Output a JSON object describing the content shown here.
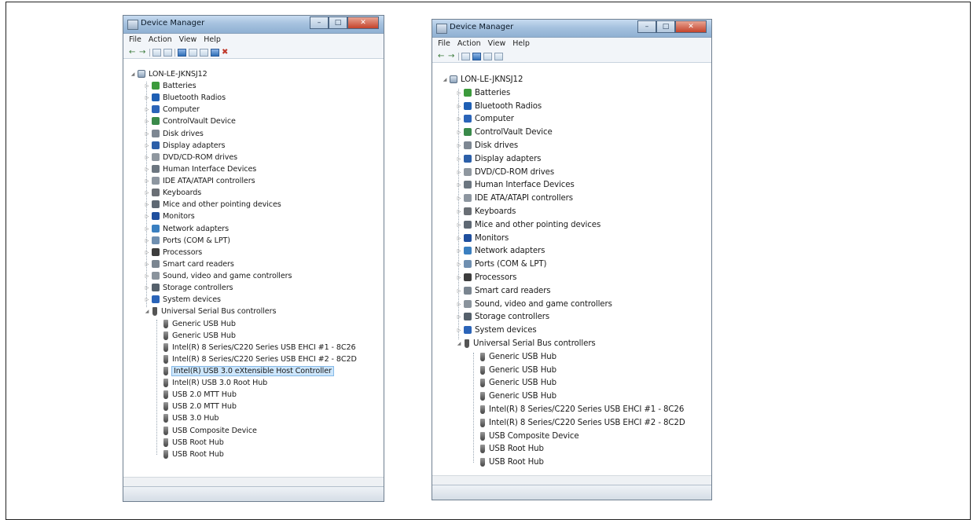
{
  "screens": [
    {
      "window_title": "Device Manager",
      "menu": [
        "File",
        "Action",
        "View",
        "Help"
      ],
      "root": "LON-LE-JKNSJ12",
      "categories": [
        {
          "label": "Batteries",
          "icon": "battery-icon",
          "color": "#3c9a3c"
        },
        {
          "label": "Bluetooth Radios",
          "icon": "bluetooth-icon",
          "color": "#1e5fb4"
        },
        {
          "label": "Computer",
          "icon": "computer-icon",
          "color": "#2b64b8"
        },
        {
          "label": "ControlVault Device",
          "icon": "controlvault-icon",
          "color": "#3a8a4a"
        },
        {
          "label": "Disk drives",
          "icon": "disk-drive-icon",
          "color": "#7d8792"
        },
        {
          "label": "Display adapters",
          "icon": "display-adapter-icon",
          "color": "#2c5fa8"
        },
        {
          "label": "DVD/CD-ROM drives",
          "icon": "dvd-drive-icon",
          "color": "#8f979f"
        },
        {
          "label": "Human Interface Devices",
          "icon": "hid-icon",
          "color": "#6c7680"
        },
        {
          "label": "IDE ATA/ATAPI controllers",
          "icon": "ide-controller-icon",
          "color": "#8d96a0"
        },
        {
          "label": "Keyboards",
          "icon": "keyboard-icon",
          "color": "#6a6f75"
        },
        {
          "label": "Mice and other pointing devices",
          "icon": "mouse-icon",
          "color": "#5e6873"
        },
        {
          "label": "Monitors",
          "icon": "monitor-icon",
          "color": "#1f4f9e"
        },
        {
          "label": "Network adapters",
          "icon": "network-adapter-icon",
          "color": "#3a7fc0"
        },
        {
          "label": "Ports (COM & LPT)",
          "icon": "port-icon",
          "color": "#6f8fb0"
        },
        {
          "label": "Processors",
          "icon": "processor-icon",
          "color": "#3d3d3d"
        },
        {
          "label": "Smart card readers",
          "icon": "smart-card-icon",
          "color": "#7a8590"
        },
        {
          "label": "Sound, video and game controllers",
          "icon": "sound-icon",
          "color": "#8a939c"
        },
        {
          "label": "Storage controllers",
          "icon": "storage-controller-icon",
          "color": "#55606b"
        },
        {
          "label": "System devices",
          "icon": "system-devices-icon",
          "color": "#2b64b8"
        },
        {
          "label": "Universal Serial Bus controllers",
          "icon": "usb-icon",
          "color": "#555555"
        }
      ],
      "usb_children": [
        "Generic USB Hub",
        "Generic USB Hub",
        "Intel(R) 8 Series/C220 Series USB EHCI #1 - 8C26",
        "Intel(R) 8 Series/C220 Series USB EHCI #2 - 8C2D",
        "Intel(R) USB 3.0 eXtensible Host Controller",
        "Intel(R) USB 3.0 Root Hub",
        "USB 2.0 MTT Hub",
        "USB 2.0 MTT Hub",
        "USB 3.0 Hub",
        "USB Composite Device",
        "USB Root Hub",
        "USB Root Hub"
      ],
      "selected_child": 4
    },
    {
      "window_title": "Device Manager",
      "menu": [
        "File",
        "Action",
        "View",
        "Help"
      ],
      "root": "LON-LE-JKNSJ12",
      "categories": [
        {
          "label": "Batteries",
          "icon": "battery-icon",
          "color": "#3c9a3c"
        },
        {
          "label": "Bluetooth Radios",
          "icon": "bluetooth-icon",
          "color": "#1e5fb4"
        },
        {
          "label": "Computer",
          "icon": "computer-icon",
          "color": "#2b64b8"
        },
        {
          "label": "ControlVault Device",
          "icon": "controlvault-icon",
          "color": "#3a8a4a"
        },
        {
          "label": "Disk drives",
          "icon": "disk-drive-icon",
          "color": "#7d8792"
        },
        {
          "label": "Display adapters",
          "icon": "display-adapter-icon",
          "color": "#2c5fa8"
        },
        {
          "label": "DVD/CD-ROM drives",
          "icon": "dvd-drive-icon",
          "color": "#8f979f"
        },
        {
          "label": "Human Interface Devices",
          "icon": "hid-icon",
          "color": "#6c7680"
        },
        {
          "label": "IDE ATA/ATAPI controllers",
          "icon": "ide-controller-icon",
          "color": "#8d96a0"
        },
        {
          "label": "Keyboards",
          "icon": "keyboard-icon",
          "color": "#6a6f75"
        },
        {
          "label": "Mice and other pointing devices",
          "icon": "mouse-icon",
          "color": "#5e6873"
        },
        {
          "label": "Monitors",
          "icon": "monitor-icon",
          "color": "#1f4f9e"
        },
        {
          "label": "Network adapters",
          "icon": "network-adapter-icon",
          "color": "#3a7fc0"
        },
        {
          "label": "Ports (COM & LPT)",
          "icon": "port-icon",
          "color": "#6f8fb0"
        },
        {
          "label": "Processors",
          "icon": "processor-icon",
          "color": "#3d3d3d"
        },
        {
          "label": "Smart card readers",
          "icon": "smart-card-icon",
          "color": "#7a8590"
        },
        {
          "label": "Sound, video and game controllers",
          "icon": "sound-icon",
          "color": "#8a939c"
        },
        {
          "label": "Storage controllers",
          "icon": "storage-controller-icon",
          "color": "#55606b"
        },
        {
          "label": "System devices",
          "icon": "system-devices-icon",
          "color": "#2b64b8"
        },
        {
          "label": "Universal Serial Bus controllers",
          "icon": "usb-icon",
          "color": "#555555"
        }
      ],
      "usb_children": [
        "Generic USB Hub",
        "Generic USB Hub",
        "Generic USB Hub",
        "Generic USB Hub",
        "Intel(R) 8 Series/C220 Series USB EHCI #1 - 8C26",
        "Intel(R) 8 Series/C220 Series USB EHCI #2 - 8C2D",
        "USB Composite Device",
        "USB Root Hub",
        "USB Root Hub"
      ],
      "selected_child": -1
    }
  ]
}
